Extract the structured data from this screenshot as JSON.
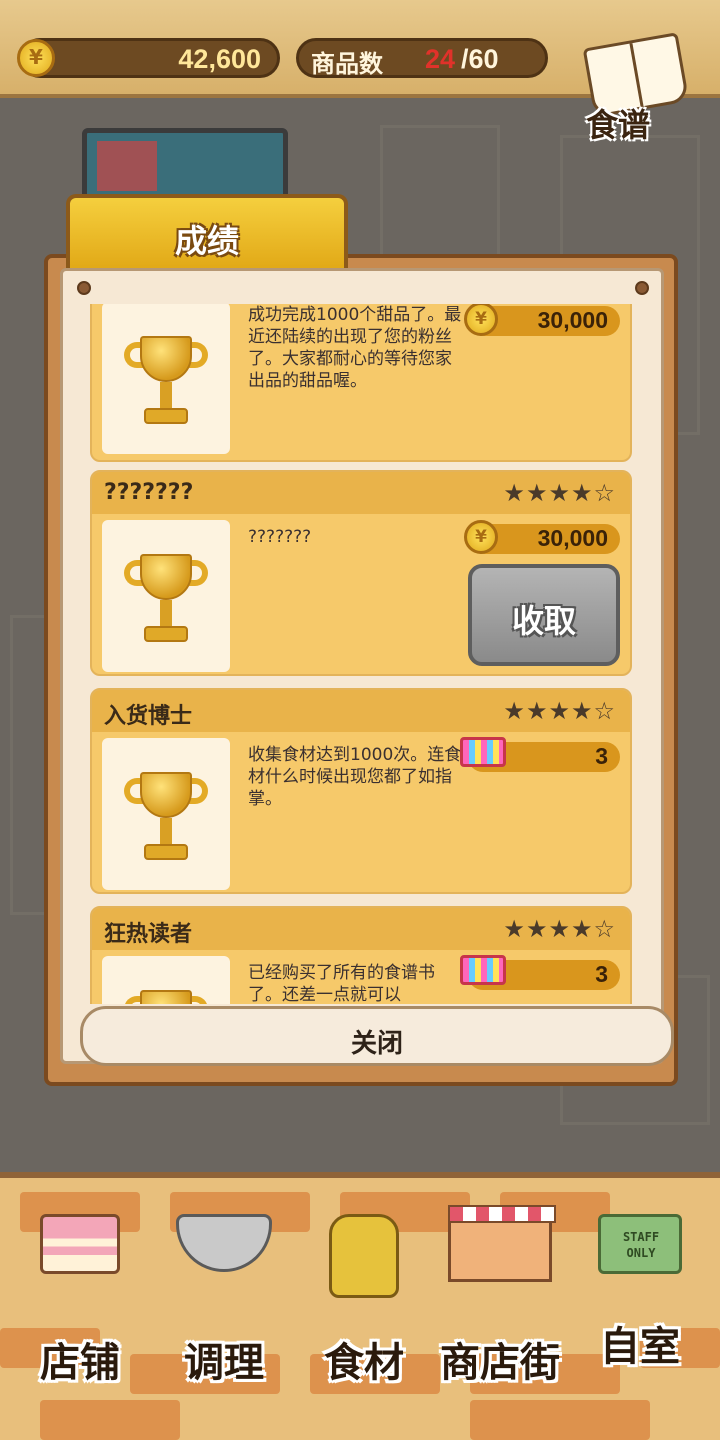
{
  "topbar": {
    "money": "42,600",
    "items_label": "商品数",
    "items_count": "24",
    "items_max": "/60",
    "recipe_label": "食谱",
    "currency_symbol": "¥"
  },
  "dialog": {
    "tab_label": "成绩",
    "close_label": "关闭",
    "cards": [
      {
        "title": "",
        "stars": "",
        "desc": "成功完成1000个甜品了。最近还陆续的出现了您的粉丝了。大家都耐心的等待您家出品的甜品喔。",
        "reward_type": "coin",
        "reward": "30,000",
        "collect": ""
      },
      {
        "title": "???????",
        "stars": "★★★★☆",
        "desc": "???????",
        "reward_type": "coin",
        "reward": "30,000",
        "collect": "收取"
      },
      {
        "title": "入货博士",
        "stars": "★★★★☆",
        "desc": "收集食材达到1000次。连食材什么时候出现您都了如指掌。",
        "reward_type": "ticket",
        "reward": "3",
        "collect": ""
      },
      {
        "title": "狂热读者",
        "stars": "★★★★☆",
        "desc": "已经购买了所有的食谱书了。还差一点就可以",
        "reward_type": "ticket",
        "reward": "3",
        "collect": ""
      }
    ]
  },
  "nav": {
    "items": [
      {
        "label": "店铺",
        "icon": "cake-icon"
      },
      {
        "label": "调理",
        "icon": "mixing-bowl-icon"
      },
      {
        "label": "食材",
        "icon": "ingredient-bag-icon"
      },
      {
        "label": "商店街",
        "icon": "shop-street-icon"
      },
      {
        "label": "自室",
        "icon": "staff-only-sign-icon"
      }
    ],
    "sign_text": "STAFF ONLY"
  },
  "colors": {
    "card_bg": "#f6c96a",
    "card_header": "#e9b34a",
    "count_red": "#e0322a",
    "collect_button": "#9e9e9e"
  }
}
